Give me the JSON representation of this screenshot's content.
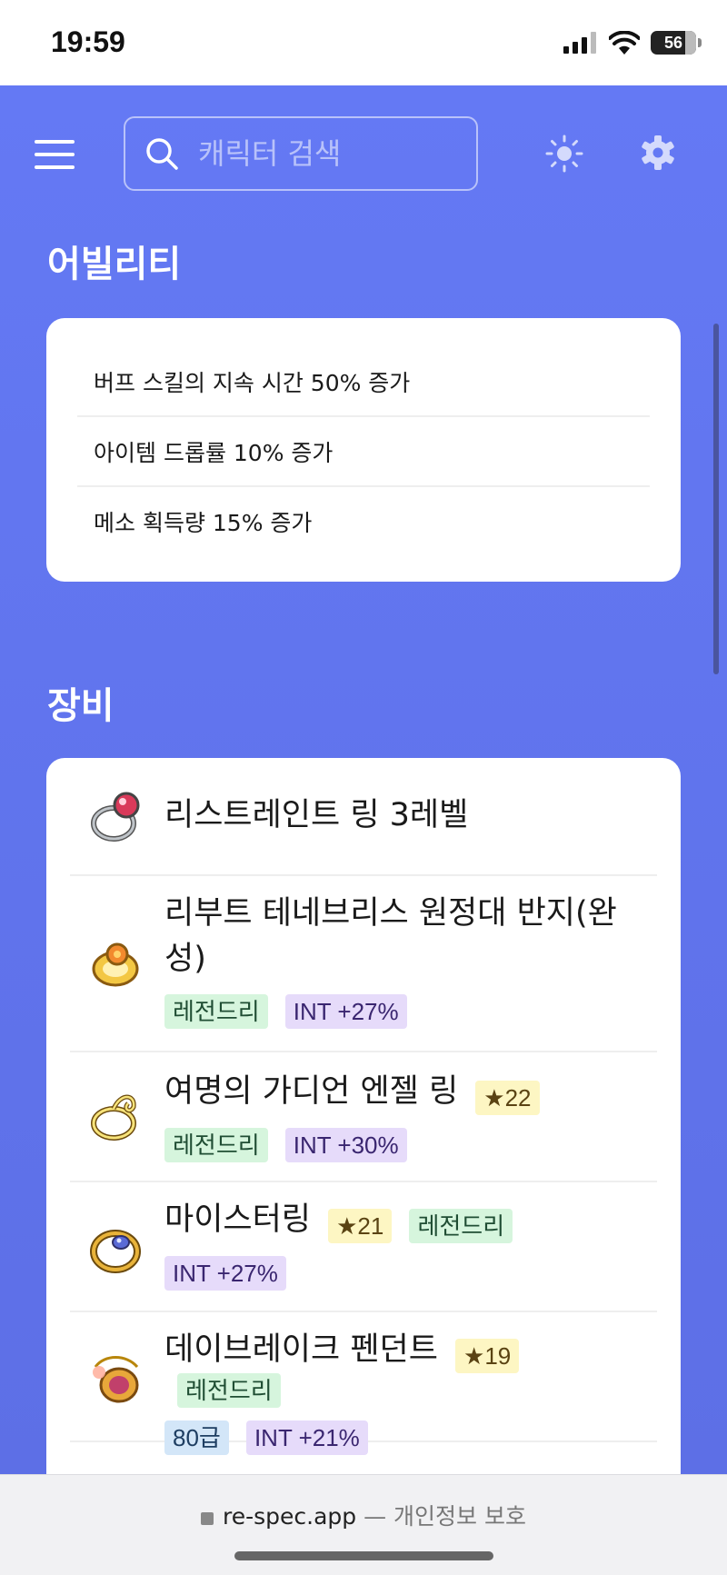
{
  "status_bar": {
    "time": "19:59",
    "battery": "56"
  },
  "header": {
    "search_placeholder": "캐릭터 검색"
  },
  "abilities": {
    "title": "어빌리티",
    "items": [
      "버프 스킬의 지속 시간 50% 증가",
      "아이템 드롭률 10% 증가",
      "메소 획득량 15% 증가"
    ]
  },
  "equipment": {
    "title": "장비",
    "items": [
      {
        "name": "리스트레인트 링 3레벨",
        "icon": "ring-icon",
        "star": "",
        "grade": "",
        "potential": "",
        "stat": ""
      },
      {
        "name": "리부트 테네브리스 원정대 반지(완성)",
        "icon": "ring-icon",
        "star": "",
        "grade": "",
        "potential": "레전드리",
        "stat": "INT +27%"
      },
      {
        "name": "여명의 가디언 엔젤 링",
        "icon": "ring-icon",
        "star": "★22",
        "grade": "",
        "potential": "레전드리",
        "stat": "INT +30%"
      },
      {
        "name": "마이스터링",
        "icon": "ring-icon",
        "star": "★21",
        "grade": "",
        "potential": "레전드리",
        "stat": "INT +27%"
      },
      {
        "name": "데이브레이크 펜던트",
        "icon": "pendant-icon",
        "star": "★19",
        "grade": "80급",
        "potential": "레전드리",
        "stat": "INT +21%"
      }
    ]
  },
  "browser": {
    "domain": "re-spec.app",
    "suffix": "— 개인정보 보호"
  },
  "colors": {
    "background": "#6479f4",
    "legendary": "#d6f5dd",
    "int_stat": "#e6dbfa",
    "star": "#fdf6c3",
    "grade": "#d3e6f8"
  }
}
